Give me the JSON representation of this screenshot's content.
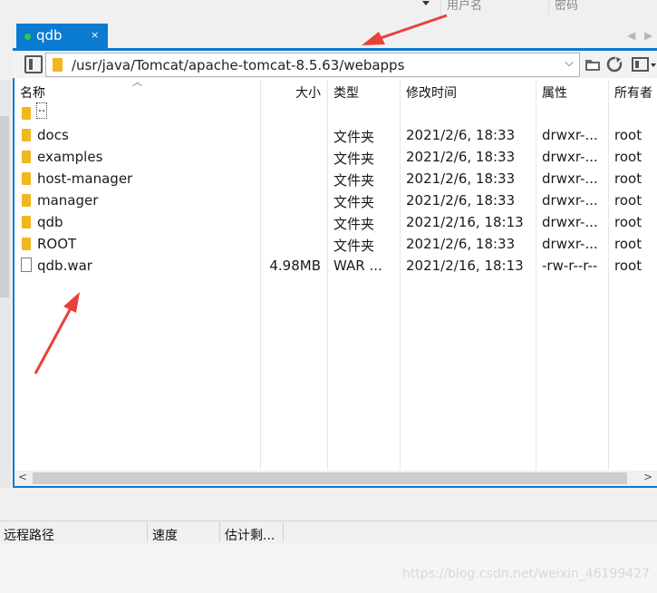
{
  "top_headers": {
    "username": "用户名",
    "password": "密码"
  },
  "tab": {
    "label": "qdb",
    "close": "×"
  },
  "nav": {
    "prev": "◀",
    "next": "▶"
  },
  "path": {
    "value": "/usr/java/Tomcat/apache-tomcat-8.5.63/webapps",
    "dropdown": "⌵"
  },
  "toolbar": {
    "open_folder_icon": "folder-open-icon",
    "refresh_icon": "refresh-icon",
    "view_icon": "view-mode-icon"
  },
  "columns": {
    "name": "名称",
    "size": "大小",
    "type": "类型",
    "modified": "修改时间",
    "attributes": "属性",
    "owner": "所有者"
  },
  "files": [
    {
      "name": "..",
      "size": "",
      "type": "",
      "modified": "",
      "attributes": "",
      "owner": "",
      "icon": "parent"
    },
    {
      "name": "docs",
      "size": "",
      "type": "文件夹",
      "modified": "2021/2/6, 18:33",
      "attributes": "drwxr-...",
      "owner": "root",
      "icon": "folder"
    },
    {
      "name": "examples",
      "size": "",
      "type": "文件夹",
      "modified": "2021/2/6, 18:33",
      "attributes": "drwxr-...",
      "owner": "root",
      "icon": "folder"
    },
    {
      "name": "host-manager",
      "size": "",
      "type": "文件夹",
      "modified": "2021/2/6, 18:33",
      "attributes": "drwxr-...",
      "owner": "root",
      "icon": "folder"
    },
    {
      "name": "manager",
      "size": "",
      "type": "文件夹",
      "modified": "2021/2/6, 18:33",
      "attributes": "drwxr-...",
      "owner": "root",
      "icon": "folder"
    },
    {
      "name": "qdb",
      "size": "",
      "type": "文件夹",
      "modified": "2021/2/16, 18:13",
      "attributes": "drwxr-...",
      "owner": "root",
      "icon": "folder"
    },
    {
      "name": "ROOT",
      "size": "",
      "type": "文件夹",
      "modified": "2021/2/6, 18:33",
      "attributes": "drwxr-...",
      "owner": "root",
      "icon": "folder"
    },
    {
      "name": "qdb.war",
      "size": "4.98MB",
      "type": "WAR ...",
      "modified": "2021/2/16, 18:13",
      "attributes": "-rw-r--r--",
      "owner": "root",
      "icon": "file"
    }
  ],
  "scroll": {
    "left": "<",
    "right": ">"
  },
  "transfer": {
    "remote_path": "远程路径",
    "speed": "速度",
    "eta": "估计剩..."
  },
  "watermark": "https://blog.csdn.net/weixin_46199427",
  "colors": {
    "accent": "#0b7ad1",
    "folder": "#f2b71e",
    "annotation": "#e8413a"
  }
}
